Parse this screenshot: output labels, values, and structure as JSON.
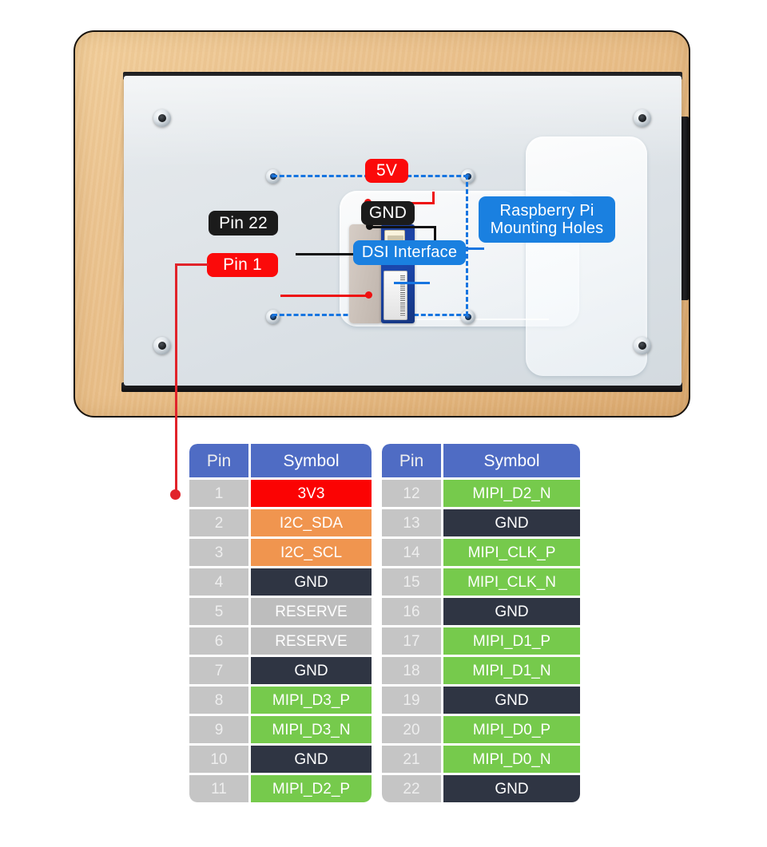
{
  "photo": {
    "alt_name": "display-module-back-photo",
    "callouts": [
      {
        "id": "5v",
        "label": "5V",
        "style": "red"
      },
      {
        "id": "gnd",
        "label": "GND",
        "style": "black"
      },
      {
        "id": "pin22",
        "label": "Pin 22",
        "style": "black"
      },
      {
        "id": "pin1",
        "label": "Pin 1",
        "style": "red"
      },
      {
        "id": "dsi",
        "label": "DSI Interface",
        "style": "blue"
      },
      {
        "id": "rpi",
        "label_line1": "Raspberry Pi",
        "label_line2": "Mounting Holes",
        "style": "blue"
      }
    ]
  },
  "colors": {
    "header_blue": "#4f6cc4",
    "pin_grey": "#c5c5c5",
    "red": "#fb0303",
    "orange": "#f0954f",
    "dark": "#2f3543",
    "grey": "#bdbdbd",
    "green": "#76ca4c",
    "callout_red": "#fb0a0a",
    "callout_black": "#1b1b1b",
    "callout_blue": "#1a80e0",
    "pointer_red": "#e1232a",
    "dashed_blue": "#1775e0"
  },
  "tables": {
    "headers": {
      "pin": "Pin",
      "symbol": "Symbol"
    },
    "left": [
      {
        "pin": "1",
        "symbol": "3V3",
        "color": "red"
      },
      {
        "pin": "2",
        "symbol": "I2C_SDA",
        "color": "orange"
      },
      {
        "pin": "3",
        "symbol": "I2C_SCL",
        "color": "orange"
      },
      {
        "pin": "4",
        "symbol": "GND",
        "color": "dark"
      },
      {
        "pin": "5",
        "symbol": "RESERVE",
        "color": "grey"
      },
      {
        "pin": "6",
        "symbol": "RESERVE",
        "color": "grey"
      },
      {
        "pin": "7",
        "symbol": "GND",
        "color": "dark"
      },
      {
        "pin": "8",
        "symbol": "MIPI_D3_P",
        "color": "green"
      },
      {
        "pin": "9",
        "symbol": "MIPI_D3_N",
        "color": "green"
      },
      {
        "pin": "10",
        "symbol": "GND",
        "color": "dark"
      },
      {
        "pin": "11",
        "symbol": "MIPI_D2_P",
        "color": "green"
      }
    ],
    "right": [
      {
        "pin": "12",
        "symbol": "MIPI_D2_N",
        "color": "green"
      },
      {
        "pin": "13",
        "symbol": "GND",
        "color": "dark"
      },
      {
        "pin": "14",
        "symbol": "MIPI_CLK_P",
        "color": "green"
      },
      {
        "pin": "15",
        "symbol": "MIPI_CLK_N",
        "color": "green"
      },
      {
        "pin": "16",
        "symbol": "GND",
        "color": "dark"
      },
      {
        "pin": "17",
        "symbol": "MIPI_D1_P",
        "color": "green"
      },
      {
        "pin": "18",
        "symbol": "MIPI_D1_N",
        "color": "green"
      },
      {
        "pin": "19",
        "symbol": "GND",
        "color": "dark"
      },
      {
        "pin": "20",
        "symbol": "MIPI_D0_P",
        "color": "green"
      },
      {
        "pin": "21",
        "symbol": "MIPI_D0_N",
        "color": "green"
      },
      {
        "pin": "22",
        "symbol": "GND",
        "color": "dark"
      }
    ]
  }
}
